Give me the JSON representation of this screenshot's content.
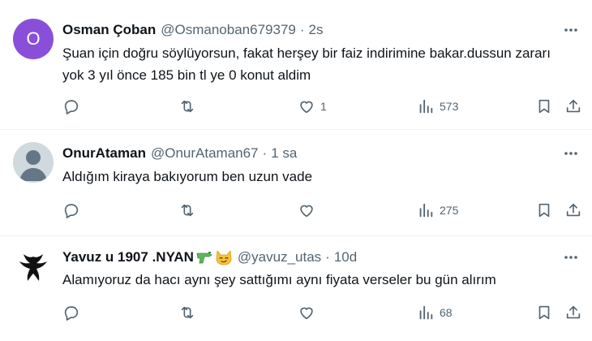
{
  "tweets": [
    {
      "avatar_letter": "O",
      "name": "Osman Çoban",
      "handle": "@Osmanoban679379",
      "separator": "·",
      "time": "2s",
      "text": "Şuan için doğru söylüyorsun, fakat herşey bir faiz indirimine bakar.dussun zararı yok 3 yıl önce 185 bin tl ye 0 konut aldim",
      "likes": "1",
      "views": "573"
    },
    {
      "name": "OnurAtaman",
      "handle": "@OnurAtaman67",
      "separator": "·",
      "time": "1 sa",
      "text": "Aldığım kiraya bakıyorum ben uzun vade",
      "views": "275"
    },
    {
      "name": "Yavuz u 1907 .NYAN",
      "name_emojis": [
        "water-pistol-icon",
        "smirking-cat-icon"
      ],
      "handle": "@yavuz_utas",
      "separator": "·",
      "time": "10d",
      "text": "Alamıyoruz da hacı aynı şey sattığımı aynı fiyata verseler bu gün alırım",
      "views": "68"
    }
  ],
  "colors": {
    "text_primary": "#0f1419",
    "text_secondary": "#536471",
    "avatar_purple": "#8a4fd8",
    "divider": "#eff3f4"
  }
}
